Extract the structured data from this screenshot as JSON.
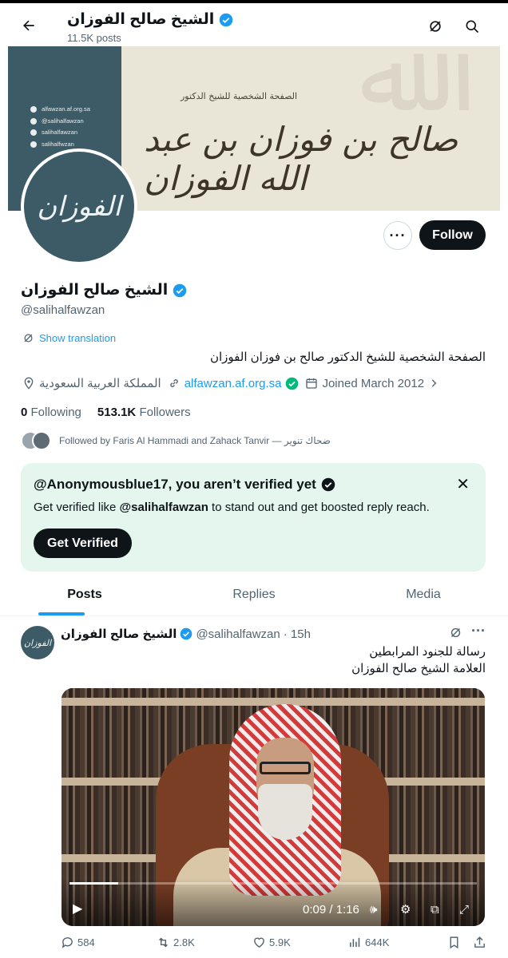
{
  "header": {
    "name": "الشيخ صالح الفوزان",
    "posts": "11.5K posts"
  },
  "banner": {
    "subtitle": "الصفحة الشخصية للشيخ الدكتور",
    "title": "صالح بن فوزان بن عبد الله الفوزان",
    "contacts": [
      "alfawzan.af.org.sa",
      "@salihalfawzan",
      "salihalfawzan",
      "salihalfwzan"
    ]
  },
  "avatar_text": "الفوزان",
  "buttons": {
    "follow": "Follow"
  },
  "profile": {
    "name": "الشيخ صالح الفوزان",
    "handle": "@salihalfawzan",
    "translate": "Show translation",
    "bio": "الصفحة الشخصية للشيخ الدكتور صالح بن فوزان الفوزان",
    "location": "المملكة العربية السعودية",
    "website": "alfawzan.af.org.sa",
    "joined": "Joined March 2012",
    "following_count": "0",
    "following_label": "Following",
    "followers_count": "513.1K",
    "followers_label": "Followers",
    "followed_by": "Followed by Faris Al Hammadi and Zahack Tanvir — ضحاك تنوير"
  },
  "verify": {
    "title": "@Anonymousblue17, you aren’t verified yet",
    "text_prefix": "Get verified like ",
    "text_handle": "@salihalfawzan",
    "text_suffix": " to stand out and get boosted reply reach.",
    "button": "Get Verified"
  },
  "tabs": [
    {
      "label": "Posts",
      "active": true
    },
    {
      "label": "Replies",
      "active": false
    },
    {
      "label": "Media",
      "active": false
    }
  ],
  "post": {
    "name": "الشيخ صالح الفوزان",
    "handle": "@salihalfawzan",
    "time": "· 15h",
    "line1": "رسالة للجنود المرابطين",
    "line2": "العلامة الشيخ صالح الفوزان",
    "video_time": "0:09 / 1:16",
    "video_progress": 0.12,
    "stats": {
      "replies": "584",
      "reposts": "2.8K",
      "likes": "5.9K",
      "views": "644K"
    }
  },
  "colors": {
    "accent": "#1d9bf0",
    "verified": "#1d9bf0",
    "banner_teal": "#3c5b66",
    "verify_bg": "#e5f6ee"
  }
}
